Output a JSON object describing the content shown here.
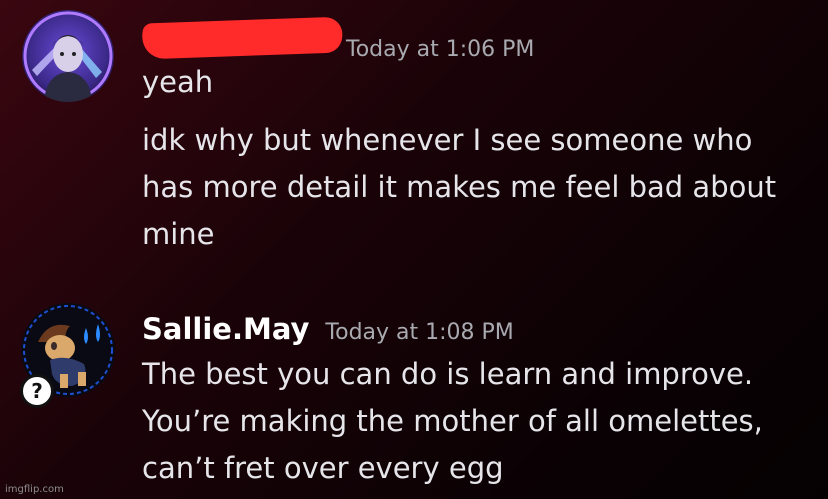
{
  "messages": [
    {
      "author": "",
      "author_redacted": true,
      "timestamp": "Today at 1:06 PM",
      "lines": [
        "yeah"
      ]
    },
    {
      "author": "",
      "author_redacted": true,
      "timestamp": "",
      "lines": [
        "idk why but whenever I see someone who",
        "has more detail it makes me feel bad about",
        "mine"
      ]
    },
    {
      "author": "Sallie.May",
      "author_redacted": false,
      "timestamp": "Today at 1:08 PM",
      "lines": [
        "The best you can do is learn and improve.",
        "You’re making the mother of all omelettes,",
        "can’t fret over every egg"
      ]
    }
  ],
  "badge": "?",
  "watermark": "imgflip.com",
  "colors": {
    "redaction": "#ff2b2b",
    "username": "#ffffff",
    "text": "#e6e6ea",
    "timestamp": "#a8aab0"
  },
  "avatars": [
    "character-avatar-1",
    "pony-avatar-2"
  ]
}
